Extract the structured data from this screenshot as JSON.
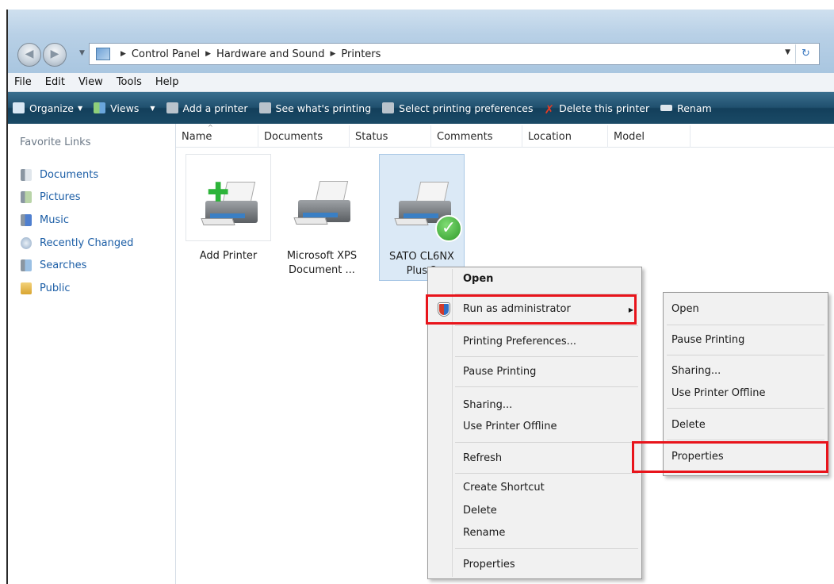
{
  "address": {
    "crumbs": [
      "Control Panel",
      "Hardware and Sound",
      "Printers"
    ]
  },
  "menubar": [
    "File",
    "Edit",
    "View",
    "Tools",
    "Help"
  ],
  "toolbar": {
    "organize": "Organize",
    "views": "Views",
    "add_printer": "Add a printer",
    "see_printing": "See what's printing",
    "select_prefs": "Select printing preferences",
    "delete_printer": "Delete this printer",
    "rename": "Renam"
  },
  "navpane": {
    "title": "Favorite Links",
    "items": [
      "Documents",
      "Pictures",
      "Music",
      "Recently Changed",
      "Searches",
      "Public"
    ]
  },
  "columns": [
    "Name",
    "Documents",
    "Status",
    "Comments",
    "Location",
    "Model"
  ],
  "tiles": [
    {
      "line1": "Add Printer",
      "line2": ""
    },
    {
      "line1": "Microsoft XPS",
      "line2": "Document ..."
    },
    {
      "line1": "SATO CL6NX",
      "line2": "Plus 2"
    }
  ],
  "context_menu": {
    "open": "Open",
    "run_as_admin": "Run as administrator",
    "printing_prefs": "Printing Preferences...",
    "pause": "Pause Printing",
    "sharing": "Sharing...",
    "offline": "Use Printer Offline",
    "refresh": "Refresh",
    "shortcut": "Create Shortcut",
    "delete": "Delete",
    "rename": "Rename",
    "properties": "Properties"
  },
  "submenu": {
    "open": "Open",
    "pause": "Pause Printing",
    "sharing": "Sharing...",
    "offline": "Use Printer Offline",
    "delete": "Delete",
    "properties": "Properties"
  },
  "colors": {
    "highlight": "#e8141b",
    "toolbar": "#1a4a66",
    "link": "#1c5ea6"
  }
}
